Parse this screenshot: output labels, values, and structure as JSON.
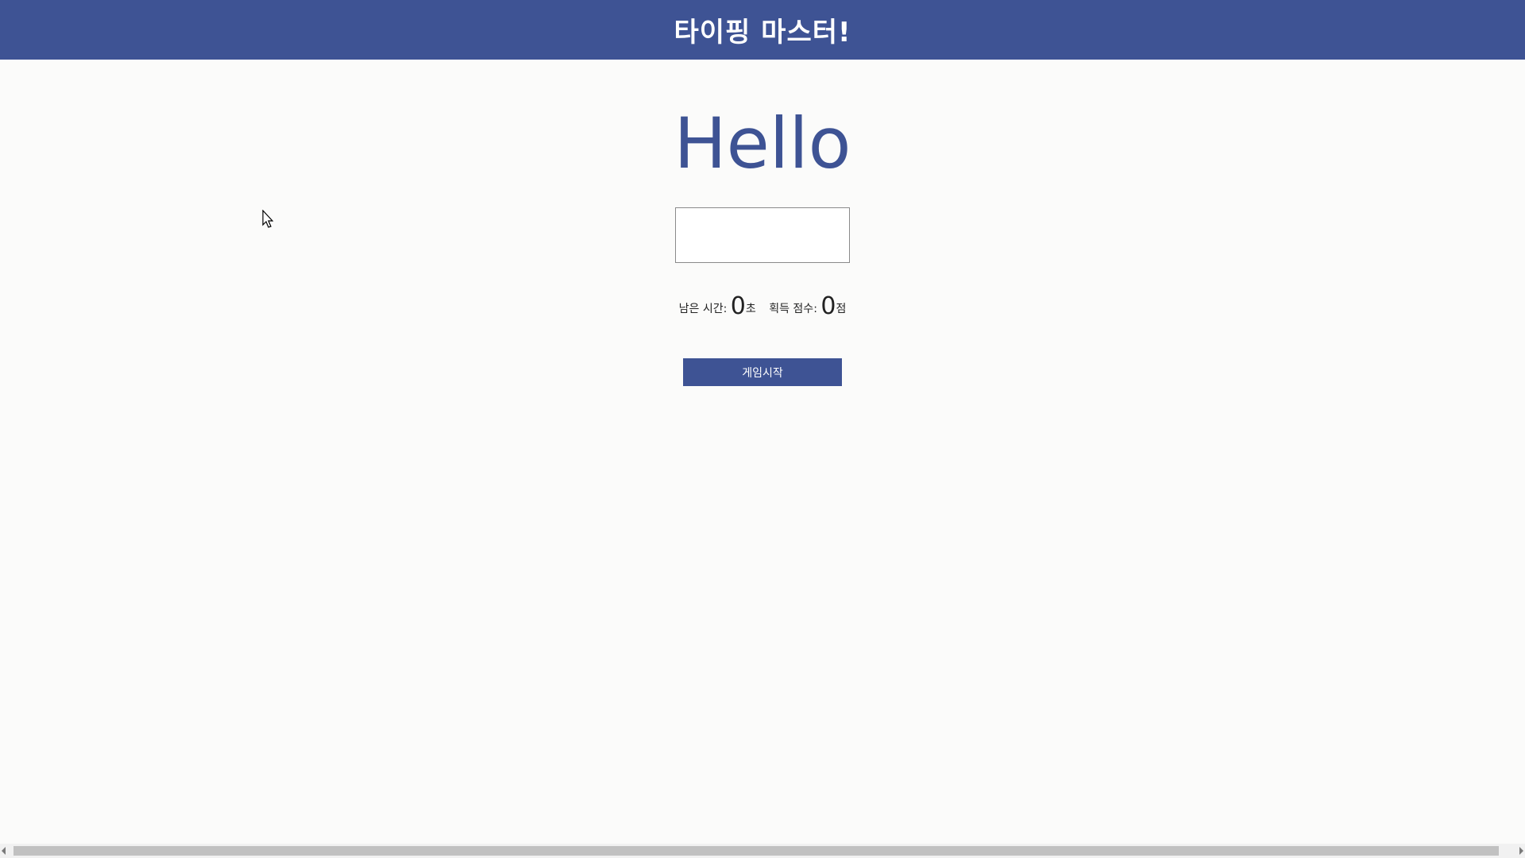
{
  "header": {
    "title": "타이핑 마스터!"
  },
  "game": {
    "word": "Hello",
    "input_value": "",
    "time_label": "남은 시간:",
    "time_value": "0",
    "time_unit": "초",
    "score_label": "획득 점수:",
    "score_value": "0",
    "score_unit": "점",
    "start_label": "게임시작"
  },
  "colors": {
    "accent": "#3e5394",
    "background": "#fbfbfa"
  },
  "icons": {
    "cursor": "mouse-pointer-icon",
    "scroll_left": "arrow-left-icon",
    "scroll_right": "arrow-right-icon"
  }
}
